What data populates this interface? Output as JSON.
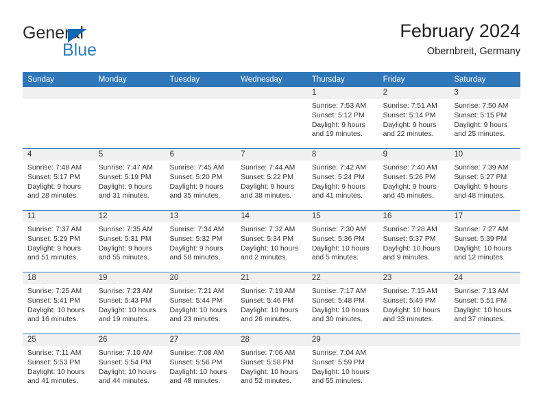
{
  "brand": {
    "name_part1": "General",
    "name_part2": "Blue",
    "accent_color": "#2b7fc6",
    "triangle_color": "#1268b3"
  },
  "header": {
    "title": "February 2024",
    "subtitle": "Obernbreit, Germany"
  },
  "theme": {
    "header_row_bg": "#2f77b8",
    "day_strip_bg": "#f0f0f0",
    "row_divider": "#2f77b8"
  },
  "weekdays": [
    "Sunday",
    "Monday",
    "Tuesday",
    "Wednesday",
    "Thursday",
    "Friday",
    "Saturday"
  ],
  "weeks": [
    [
      {
        "day": "",
        "empty": true
      },
      {
        "day": "",
        "empty": true
      },
      {
        "day": "",
        "empty": true
      },
      {
        "day": "",
        "empty": true
      },
      {
        "day": "1",
        "sunrise": "Sunrise: 7:53 AM",
        "sunset": "Sunset: 5:12 PM",
        "daylight_1": "Daylight: 9 hours",
        "daylight_2": "and 19 minutes."
      },
      {
        "day": "2",
        "sunrise": "Sunrise: 7:51 AM",
        "sunset": "Sunset: 5:14 PM",
        "daylight_1": "Daylight: 9 hours",
        "daylight_2": "and 22 minutes."
      },
      {
        "day": "3",
        "sunrise": "Sunrise: 7:50 AM",
        "sunset": "Sunset: 5:15 PM",
        "daylight_1": "Daylight: 9 hours",
        "daylight_2": "and 25 minutes."
      }
    ],
    [
      {
        "day": "4",
        "sunrise": "Sunrise: 7:48 AM",
        "sunset": "Sunset: 5:17 PM",
        "daylight_1": "Daylight: 9 hours",
        "daylight_2": "and 28 minutes."
      },
      {
        "day": "5",
        "sunrise": "Sunrise: 7:47 AM",
        "sunset": "Sunset: 5:19 PM",
        "daylight_1": "Daylight: 9 hours",
        "daylight_2": "and 31 minutes."
      },
      {
        "day": "6",
        "sunrise": "Sunrise: 7:45 AM",
        "sunset": "Sunset: 5:20 PM",
        "daylight_1": "Daylight: 9 hours",
        "daylight_2": "and 35 minutes."
      },
      {
        "day": "7",
        "sunrise": "Sunrise: 7:44 AM",
        "sunset": "Sunset: 5:22 PM",
        "daylight_1": "Daylight: 9 hours",
        "daylight_2": "and 38 minutes."
      },
      {
        "day": "8",
        "sunrise": "Sunrise: 7:42 AM",
        "sunset": "Sunset: 5:24 PM",
        "daylight_1": "Daylight: 9 hours",
        "daylight_2": "and 41 minutes."
      },
      {
        "day": "9",
        "sunrise": "Sunrise: 7:40 AM",
        "sunset": "Sunset: 5:26 PM",
        "daylight_1": "Daylight: 9 hours",
        "daylight_2": "and 45 minutes."
      },
      {
        "day": "10",
        "sunrise": "Sunrise: 7:39 AM",
        "sunset": "Sunset: 5:27 PM",
        "daylight_1": "Daylight: 9 hours",
        "daylight_2": "and 48 minutes."
      }
    ],
    [
      {
        "day": "11",
        "sunrise": "Sunrise: 7:37 AM",
        "sunset": "Sunset: 5:29 PM",
        "daylight_1": "Daylight: 9 hours",
        "daylight_2": "and 51 minutes."
      },
      {
        "day": "12",
        "sunrise": "Sunrise: 7:35 AM",
        "sunset": "Sunset: 5:31 PM",
        "daylight_1": "Daylight: 9 hours",
        "daylight_2": "and 55 minutes."
      },
      {
        "day": "13",
        "sunrise": "Sunrise: 7:34 AM",
        "sunset": "Sunset: 5:32 PM",
        "daylight_1": "Daylight: 9 hours",
        "daylight_2": "and 58 minutes."
      },
      {
        "day": "14",
        "sunrise": "Sunrise: 7:32 AM",
        "sunset": "Sunset: 5:34 PM",
        "daylight_1": "Daylight: 10 hours",
        "daylight_2": "and 2 minutes."
      },
      {
        "day": "15",
        "sunrise": "Sunrise: 7:30 AM",
        "sunset": "Sunset: 5:36 PM",
        "daylight_1": "Daylight: 10 hours",
        "daylight_2": "and 5 minutes."
      },
      {
        "day": "16",
        "sunrise": "Sunrise: 7:28 AM",
        "sunset": "Sunset: 5:37 PM",
        "daylight_1": "Daylight: 10 hours",
        "daylight_2": "and 9 minutes."
      },
      {
        "day": "17",
        "sunrise": "Sunrise: 7:27 AM",
        "sunset": "Sunset: 5:39 PM",
        "daylight_1": "Daylight: 10 hours",
        "daylight_2": "and 12 minutes."
      }
    ],
    [
      {
        "day": "18",
        "sunrise": "Sunrise: 7:25 AM",
        "sunset": "Sunset: 5:41 PM",
        "daylight_1": "Daylight: 10 hours",
        "daylight_2": "and 16 minutes."
      },
      {
        "day": "19",
        "sunrise": "Sunrise: 7:23 AM",
        "sunset": "Sunset: 5:43 PM",
        "daylight_1": "Daylight: 10 hours",
        "daylight_2": "and 19 minutes."
      },
      {
        "day": "20",
        "sunrise": "Sunrise: 7:21 AM",
        "sunset": "Sunset: 5:44 PM",
        "daylight_1": "Daylight: 10 hours",
        "daylight_2": "and 23 minutes."
      },
      {
        "day": "21",
        "sunrise": "Sunrise: 7:19 AM",
        "sunset": "Sunset: 5:46 PM",
        "daylight_1": "Daylight: 10 hours",
        "daylight_2": "and 26 minutes."
      },
      {
        "day": "22",
        "sunrise": "Sunrise: 7:17 AM",
        "sunset": "Sunset: 5:48 PM",
        "daylight_1": "Daylight: 10 hours",
        "daylight_2": "and 30 minutes."
      },
      {
        "day": "23",
        "sunrise": "Sunrise: 7:15 AM",
        "sunset": "Sunset: 5:49 PM",
        "daylight_1": "Daylight: 10 hours",
        "daylight_2": "and 33 minutes."
      },
      {
        "day": "24",
        "sunrise": "Sunrise: 7:13 AM",
        "sunset": "Sunset: 5:51 PM",
        "daylight_1": "Daylight: 10 hours",
        "daylight_2": "and 37 minutes."
      }
    ],
    [
      {
        "day": "25",
        "sunrise": "Sunrise: 7:11 AM",
        "sunset": "Sunset: 5:53 PM",
        "daylight_1": "Daylight: 10 hours",
        "daylight_2": "and 41 minutes."
      },
      {
        "day": "26",
        "sunrise": "Sunrise: 7:10 AM",
        "sunset": "Sunset: 5:54 PM",
        "daylight_1": "Daylight: 10 hours",
        "daylight_2": "and 44 minutes."
      },
      {
        "day": "27",
        "sunrise": "Sunrise: 7:08 AM",
        "sunset": "Sunset: 5:56 PM",
        "daylight_1": "Daylight: 10 hours",
        "daylight_2": "and 48 minutes."
      },
      {
        "day": "28",
        "sunrise": "Sunrise: 7:06 AM",
        "sunset": "Sunset: 5:58 PM",
        "daylight_1": "Daylight: 10 hours",
        "daylight_2": "and 52 minutes."
      },
      {
        "day": "29",
        "sunrise": "Sunrise: 7:04 AM",
        "sunset": "Sunset: 5:59 PM",
        "daylight_1": "Daylight: 10 hours",
        "daylight_2": "and 55 minutes."
      },
      {
        "day": "",
        "empty": true
      },
      {
        "day": "",
        "empty": true
      }
    ]
  ]
}
